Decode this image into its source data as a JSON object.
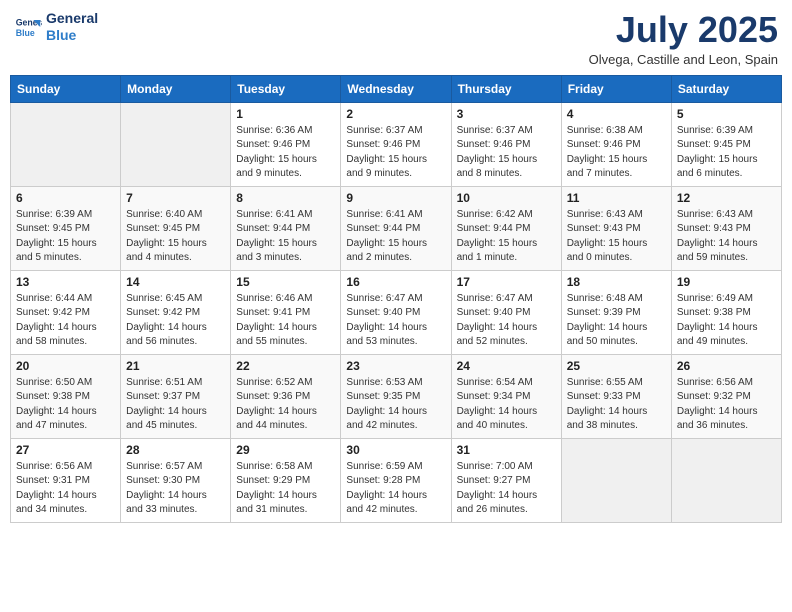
{
  "header": {
    "logo_line1": "General",
    "logo_line2": "Blue",
    "month_title": "July 2025",
    "location": "Olvega, Castille and Leon, Spain"
  },
  "days_of_week": [
    "Sunday",
    "Monday",
    "Tuesday",
    "Wednesday",
    "Thursday",
    "Friday",
    "Saturday"
  ],
  "weeks": [
    [
      {
        "day": "",
        "info": ""
      },
      {
        "day": "",
        "info": ""
      },
      {
        "day": "1",
        "info": "Sunrise: 6:36 AM\nSunset: 9:46 PM\nDaylight: 15 hours and 9 minutes."
      },
      {
        "day": "2",
        "info": "Sunrise: 6:37 AM\nSunset: 9:46 PM\nDaylight: 15 hours and 9 minutes."
      },
      {
        "day": "3",
        "info": "Sunrise: 6:37 AM\nSunset: 9:46 PM\nDaylight: 15 hours and 8 minutes."
      },
      {
        "day": "4",
        "info": "Sunrise: 6:38 AM\nSunset: 9:46 PM\nDaylight: 15 hours and 7 minutes."
      },
      {
        "day": "5",
        "info": "Sunrise: 6:39 AM\nSunset: 9:45 PM\nDaylight: 15 hours and 6 minutes."
      }
    ],
    [
      {
        "day": "6",
        "info": "Sunrise: 6:39 AM\nSunset: 9:45 PM\nDaylight: 15 hours and 5 minutes."
      },
      {
        "day": "7",
        "info": "Sunrise: 6:40 AM\nSunset: 9:45 PM\nDaylight: 15 hours and 4 minutes."
      },
      {
        "day": "8",
        "info": "Sunrise: 6:41 AM\nSunset: 9:44 PM\nDaylight: 15 hours and 3 minutes."
      },
      {
        "day": "9",
        "info": "Sunrise: 6:41 AM\nSunset: 9:44 PM\nDaylight: 15 hours and 2 minutes."
      },
      {
        "day": "10",
        "info": "Sunrise: 6:42 AM\nSunset: 9:44 PM\nDaylight: 15 hours and 1 minute."
      },
      {
        "day": "11",
        "info": "Sunrise: 6:43 AM\nSunset: 9:43 PM\nDaylight: 15 hours and 0 minutes."
      },
      {
        "day": "12",
        "info": "Sunrise: 6:43 AM\nSunset: 9:43 PM\nDaylight: 14 hours and 59 minutes."
      }
    ],
    [
      {
        "day": "13",
        "info": "Sunrise: 6:44 AM\nSunset: 9:42 PM\nDaylight: 14 hours and 58 minutes."
      },
      {
        "day": "14",
        "info": "Sunrise: 6:45 AM\nSunset: 9:42 PM\nDaylight: 14 hours and 56 minutes."
      },
      {
        "day": "15",
        "info": "Sunrise: 6:46 AM\nSunset: 9:41 PM\nDaylight: 14 hours and 55 minutes."
      },
      {
        "day": "16",
        "info": "Sunrise: 6:47 AM\nSunset: 9:40 PM\nDaylight: 14 hours and 53 minutes."
      },
      {
        "day": "17",
        "info": "Sunrise: 6:47 AM\nSunset: 9:40 PM\nDaylight: 14 hours and 52 minutes."
      },
      {
        "day": "18",
        "info": "Sunrise: 6:48 AM\nSunset: 9:39 PM\nDaylight: 14 hours and 50 minutes."
      },
      {
        "day": "19",
        "info": "Sunrise: 6:49 AM\nSunset: 9:38 PM\nDaylight: 14 hours and 49 minutes."
      }
    ],
    [
      {
        "day": "20",
        "info": "Sunrise: 6:50 AM\nSunset: 9:38 PM\nDaylight: 14 hours and 47 minutes."
      },
      {
        "day": "21",
        "info": "Sunrise: 6:51 AM\nSunset: 9:37 PM\nDaylight: 14 hours and 45 minutes."
      },
      {
        "day": "22",
        "info": "Sunrise: 6:52 AM\nSunset: 9:36 PM\nDaylight: 14 hours and 44 minutes."
      },
      {
        "day": "23",
        "info": "Sunrise: 6:53 AM\nSunset: 9:35 PM\nDaylight: 14 hours and 42 minutes."
      },
      {
        "day": "24",
        "info": "Sunrise: 6:54 AM\nSunset: 9:34 PM\nDaylight: 14 hours and 40 minutes."
      },
      {
        "day": "25",
        "info": "Sunrise: 6:55 AM\nSunset: 9:33 PM\nDaylight: 14 hours and 38 minutes."
      },
      {
        "day": "26",
        "info": "Sunrise: 6:56 AM\nSunset: 9:32 PM\nDaylight: 14 hours and 36 minutes."
      }
    ],
    [
      {
        "day": "27",
        "info": "Sunrise: 6:56 AM\nSunset: 9:31 PM\nDaylight: 14 hours and 34 minutes."
      },
      {
        "day": "28",
        "info": "Sunrise: 6:57 AM\nSunset: 9:30 PM\nDaylight: 14 hours and 33 minutes."
      },
      {
        "day": "29",
        "info": "Sunrise: 6:58 AM\nSunset: 9:29 PM\nDaylight: 14 hours and 31 minutes."
      },
      {
        "day": "30",
        "info": "Sunrise: 6:59 AM\nSunset: 9:28 PM\nDaylight: 14 hours and 42 minutes."
      },
      {
        "day": "31",
        "info": "Sunrise: 7:00 AM\nSunset: 9:27 PM\nDaylight: 14 hours and 26 minutes."
      },
      {
        "day": "",
        "info": ""
      },
      {
        "day": "",
        "info": ""
      }
    ]
  ]
}
